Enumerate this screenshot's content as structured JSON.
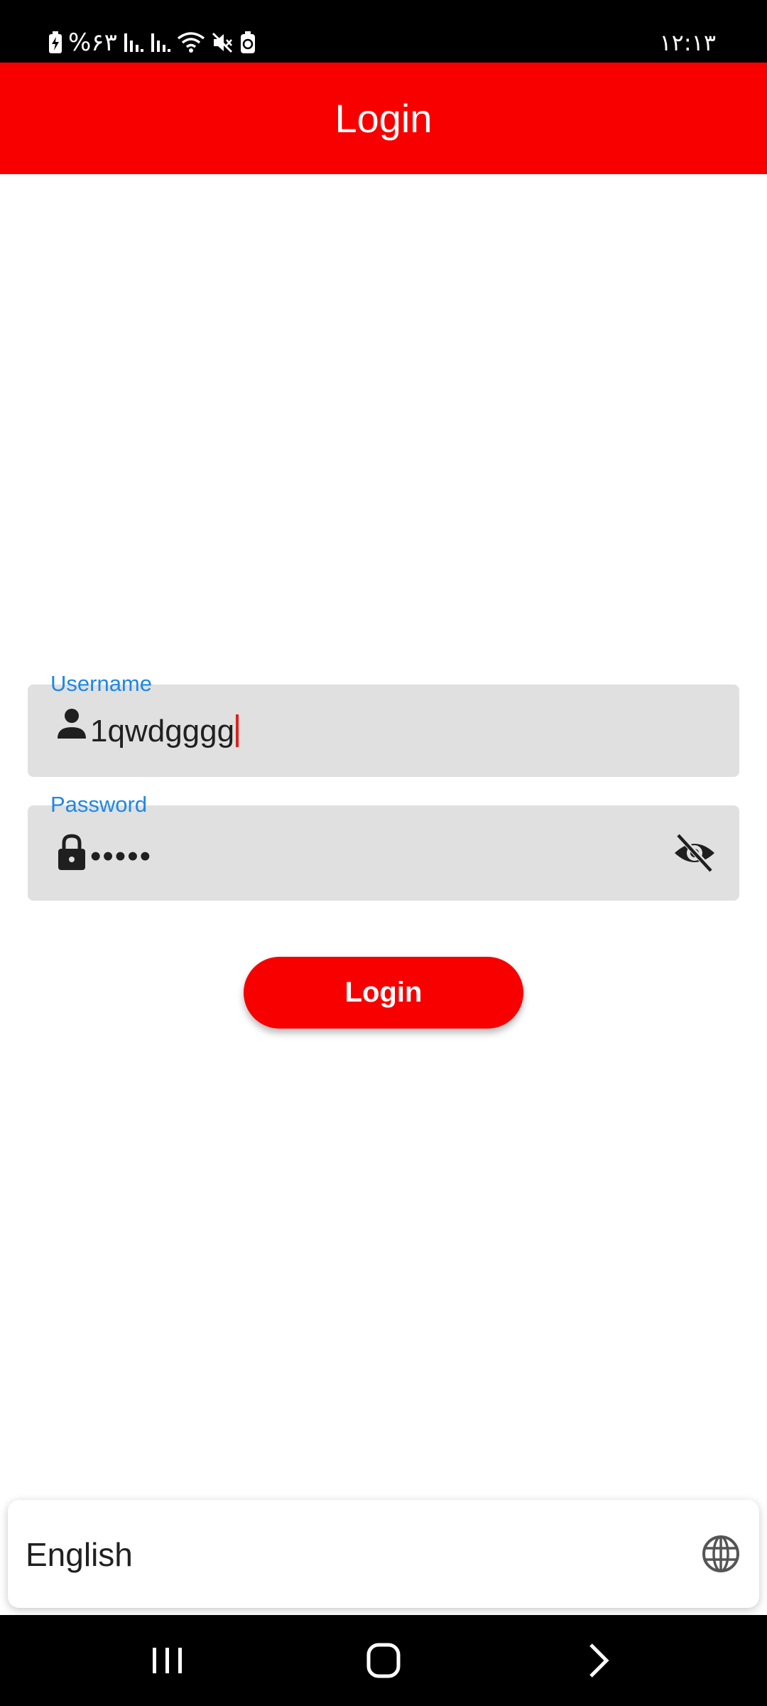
{
  "status_bar": {
    "time": "۱۲:۱۳",
    "battery_text": "%۶۳",
    "icons": [
      "battery-charging-icon",
      "signal-icon",
      "signal-icon",
      "wifi-icon",
      "mute-icon",
      "battery-saver-icon"
    ]
  },
  "app_bar": {
    "title": "Login",
    "color": "#f80000"
  },
  "form": {
    "username": {
      "label": "Username",
      "value": "1qwdgggg",
      "icon": "person-icon"
    },
    "password": {
      "label": "Password",
      "value": "•••••",
      "icon": "lock-icon",
      "toggle_icon": "eye-off-icon"
    },
    "login_button_label": "Login"
  },
  "language_selector": {
    "label": "English",
    "icon": "globe-icon"
  },
  "nav_bar": {
    "icons": [
      "recent-apps-icon",
      "home-icon",
      "back-icon"
    ]
  },
  "colors": {
    "accent": "#f80000",
    "label": "#1e88e5",
    "field_bg": "#e0e0e0"
  }
}
